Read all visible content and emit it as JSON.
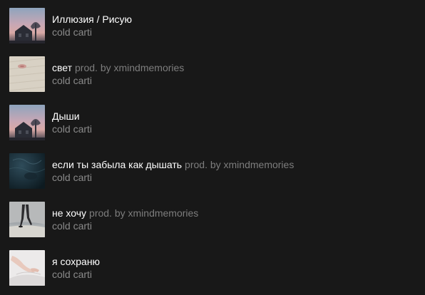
{
  "tracks": [
    {
      "title": "Иллюзия / Рисую",
      "version": "",
      "artist": "cold carti",
      "cover": "house-sunset-cover"
    },
    {
      "title": "свет",
      "version": "prod. by xmindmemories",
      "artist": "cold carti",
      "cover": "paper-lips-cover"
    },
    {
      "title": "Дыши",
      "version": "",
      "artist": "cold carti",
      "cover": "house-sunset-cover"
    },
    {
      "title": "если ты забыла как дышать",
      "version": "prod. by xmindmemories",
      "artist": "cold carti",
      "cover": "underwater-cover"
    },
    {
      "title": "не хочу",
      "version": "prod. by xmindmemories",
      "artist": "cold carti",
      "cover": "beach-legs-cover"
    },
    {
      "title": "я сохраню",
      "version": "",
      "artist": "cold carti",
      "cover": "hand-on-sheets-cover"
    }
  ]
}
